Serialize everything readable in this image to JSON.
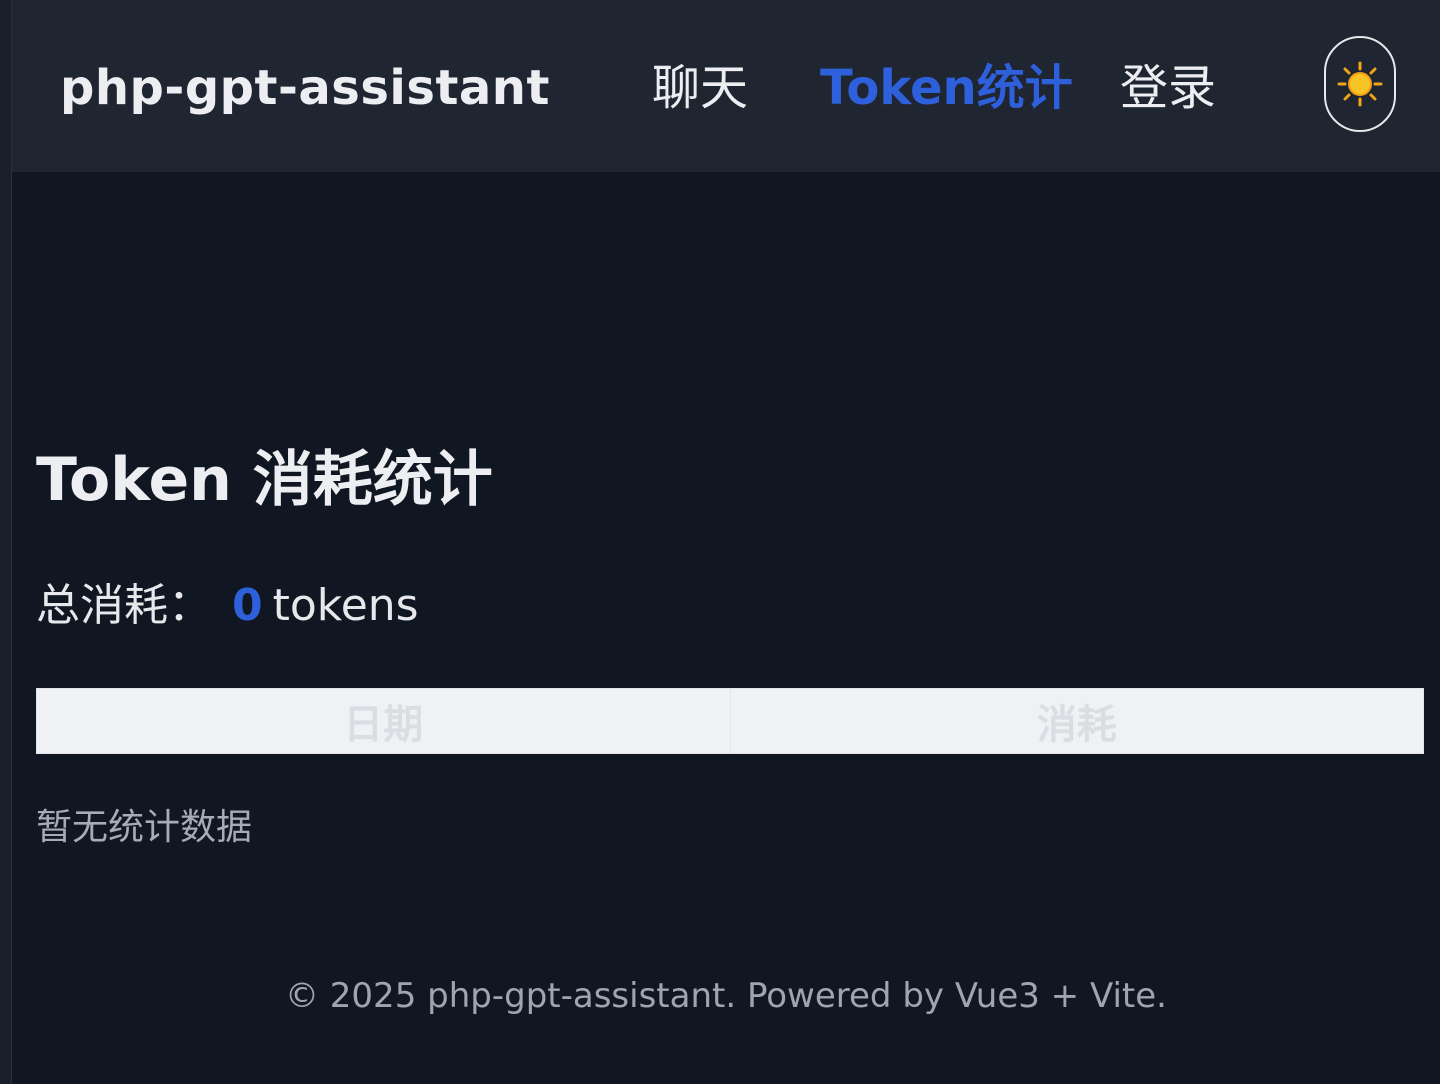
{
  "header": {
    "brand": "php-gpt-assistant",
    "nav": [
      {
        "label": "聊天",
        "active": false
      },
      {
        "label": "Token统计",
        "active": true
      },
      {
        "label": "登录",
        "active": false
      }
    ],
    "theme_toggle_icon": "sun-icon"
  },
  "main": {
    "title": "Token 消耗统计",
    "total_label": "总消耗：",
    "total_value": "0",
    "total_unit": "tokens",
    "table": {
      "columns": [
        "日期",
        "消耗"
      ],
      "rows": []
    },
    "empty_message": "暂无统计数据"
  },
  "footer": {
    "text": "© 2025 php-gpt-assistant. Powered by Vue3 + Vite."
  },
  "colors": {
    "background": "#111722",
    "header_background": "#1f2531",
    "accent": "#2f60dc",
    "text": "#eceef2",
    "muted_text": "#9fa5b0"
  }
}
